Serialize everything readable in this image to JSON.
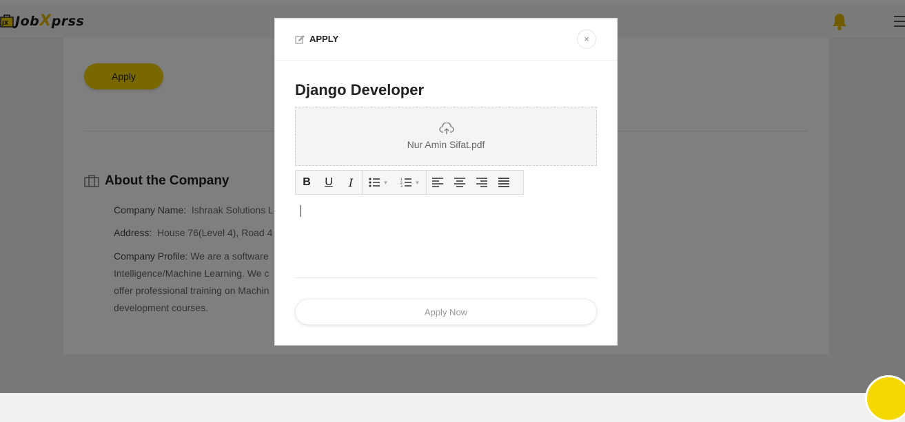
{
  "app": {
    "logo_text_a": "Job",
    "logo_text_x": "X",
    "logo_text_b": "prss",
    "logo_mark": "JX"
  },
  "page": {
    "apply_label": "Apply",
    "about_title": "About the Company",
    "company_name_label": "Company Name:",
    "company_name_value": "Ishraak Solutions L",
    "address_label": "Address:",
    "address_value": "House 76(Level 4), Road 4",
    "profile_label": "Company Profile:",
    "profile_value": "We are a software",
    "profile_line2": "Intelligence/Machine Learning. We c",
    "profile_line3": "offer professional training on Machin",
    "profile_line4": "development courses."
  },
  "modal": {
    "title": "APPLY",
    "close_label": "×",
    "job_title": "Django Developer",
    "file_name": "Nur Amin Sifat.pdf",
    "toolbar": {
      "bold": "B",
      "underline": "U",
      "italic": "I"
    },
    "submit_label": "Apply Now"
  },
  "colors": {
    "accent": "#f2d000",
    "overlay": "rgba(0,0,0,0.5)"
  },
  "icons": [
    "bell-icon",
    "hamburger-menu-icon",
    "edit-icon",
    "close-icon",
    "upload-cloud-icon",
    "briefcase-icon",
    "bullet-list-icon",
    "numbered-list-icon",
    "align-left-icon",
    "align-center-icon",
    "align-right-icon",
    "align-justify-icon"
  ]
}
